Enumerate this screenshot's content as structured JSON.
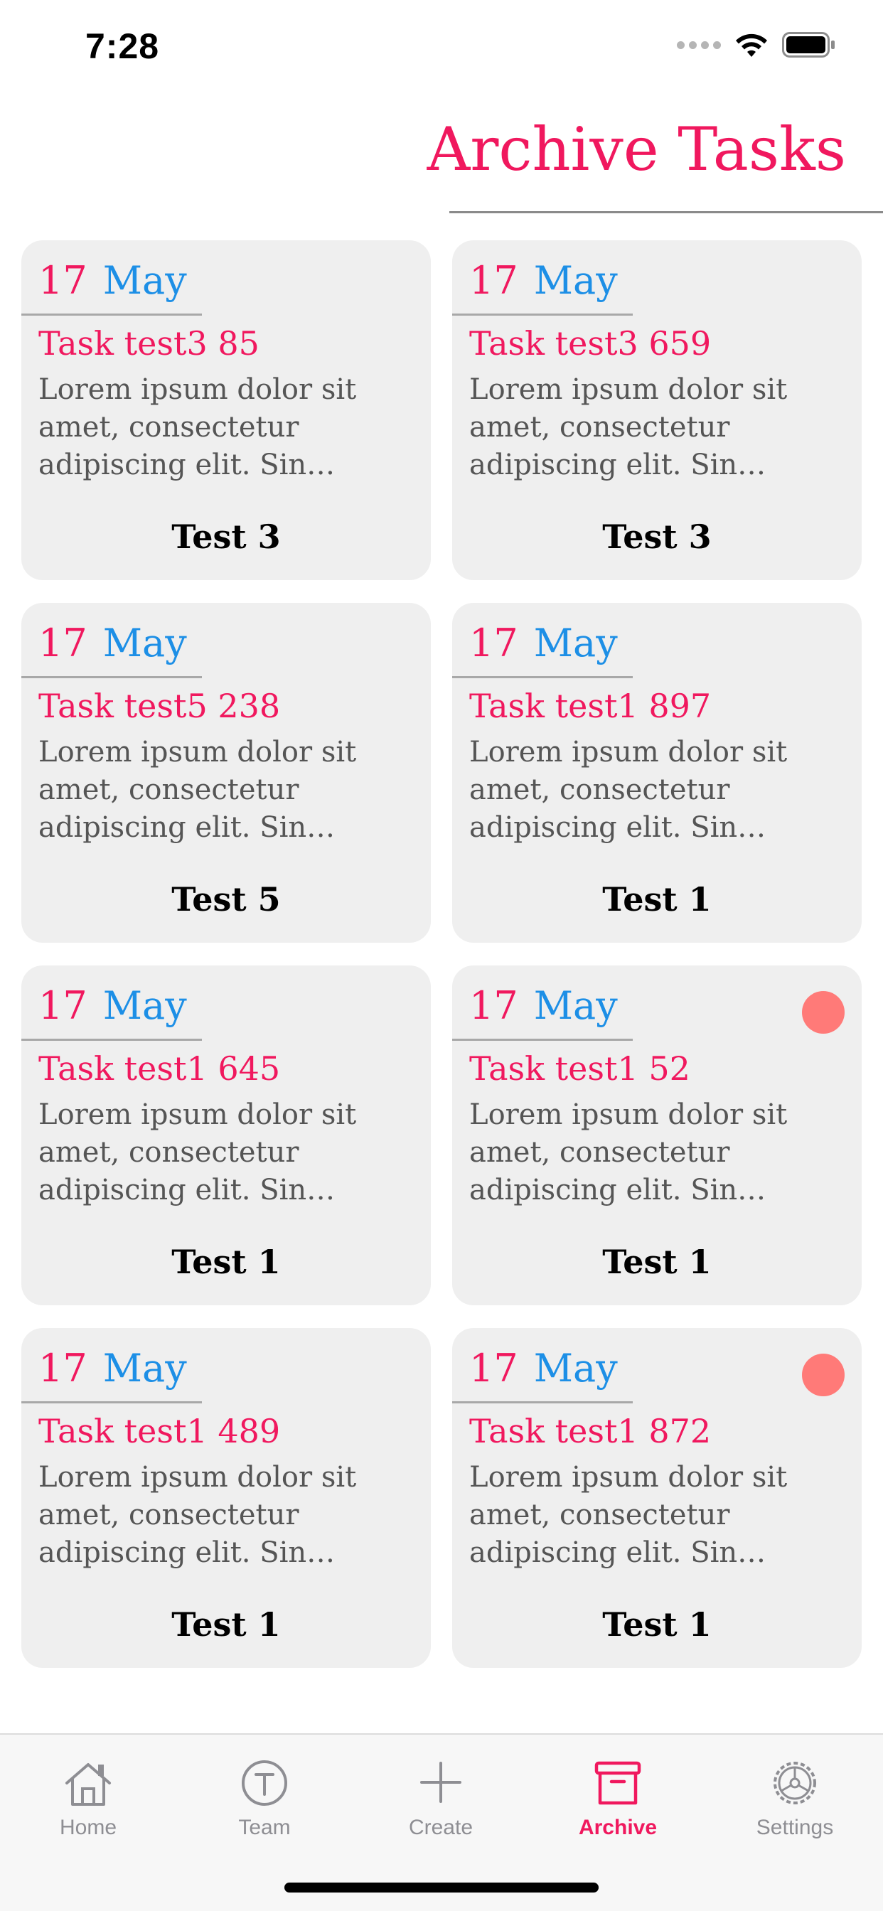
{
  "status_bar": {
    "time": "7:28"
  },
  "header": {
    "title": "Archive Tasks"
  },
  "cards": [
    {
      "day": "17",
      "month": "May",
      "title": "Task test3 85",
      "description": "Lorem ipsum dolor sit amet, consectetur adipiscing elit. Sin labor…",
      "footer": "Test 3",
      "has_dot": false
    },
    {
      "day": "17",
      "month": "May",
      "title": "Task test3 659",
      "description": "Lorem ipsum dolor sit amet, consectetur adipiscing elit. Sin labor…",
      "footer": "Test 3",
      "has_dot": false
    },
    {
      "day": "17",
      "month": "May",
      "title": "Task test5 238",
      "description": "Lorem ipsum dolor sit amet, consectetur adipiscing elit. Sin labor…",
      "footer": "Test 5",
      "has_dot": false
    },
    {
      "day": "17",
      "month": "May",
      "title": "Task test1 897",
      "description": "Lorem ipsum dolor sit amet, consectetur adipiscing elit. Sin labor…",
      "footer": "Test 1",
      "has_dot": false
    },
    {
      "day": "17",
      "month": "May",
      "title": "Task test1 645",
      "description": "Lorem ipsum dolor sit amet, consectetur adipiscing elit. Sin labor…",
      "footer": "Test 1",
      "has_dot": false
    },
    {
      "day": "17",
      "month": "May",
      "title": "Task test1 52",
      "description": "Lorem ipsum dolor sit amet, consectetur adipiscing elit. Sin labor…",
      "footer": "Test 1",
      "has_dot": true
    },
    {
      "day": "17",
      "month": "May",
      "title": "Task test1 489",
      "description": "Lorem ipsum dolor sit amet, consectetur adipiscing elit. Sin labor…",
      "footer": "Test 1",
      "has_dot": false
    },
    {
      "day": "17",
      "month": "May",
      "title": "Task test1 872",
      "description": "Lorem ipsum dolor sit amet, consectetur adipiscing elit. Sin labor…",
      "footer": "Test 1",
      "has_dot": true
    }
  ],
  "tab_bar": {
    "active": "Archive",
    "tabs": [
      {
        "label": "Home",
        "icon": "home-icon"
      },
      {
        "label": "Team",
        "icon": "team-icon"
      },
      {
        "label": "Create",
        "icon": "plus-icon"
      },
      {
        "label": "Archive",
        "icon": "archive-box-icon"
      },
      {
        "label": "Settings",
        "icon": "gear-icon"
      }
    ]
  },
  "colors": {
    "accent": "#f0185e",
    "month_blue": "#1d8fe6",
    "card_bg": "#efefef",
    "dot": "#ff7a78",
    "tab_inactive": "#8e8e93"
  }
}
